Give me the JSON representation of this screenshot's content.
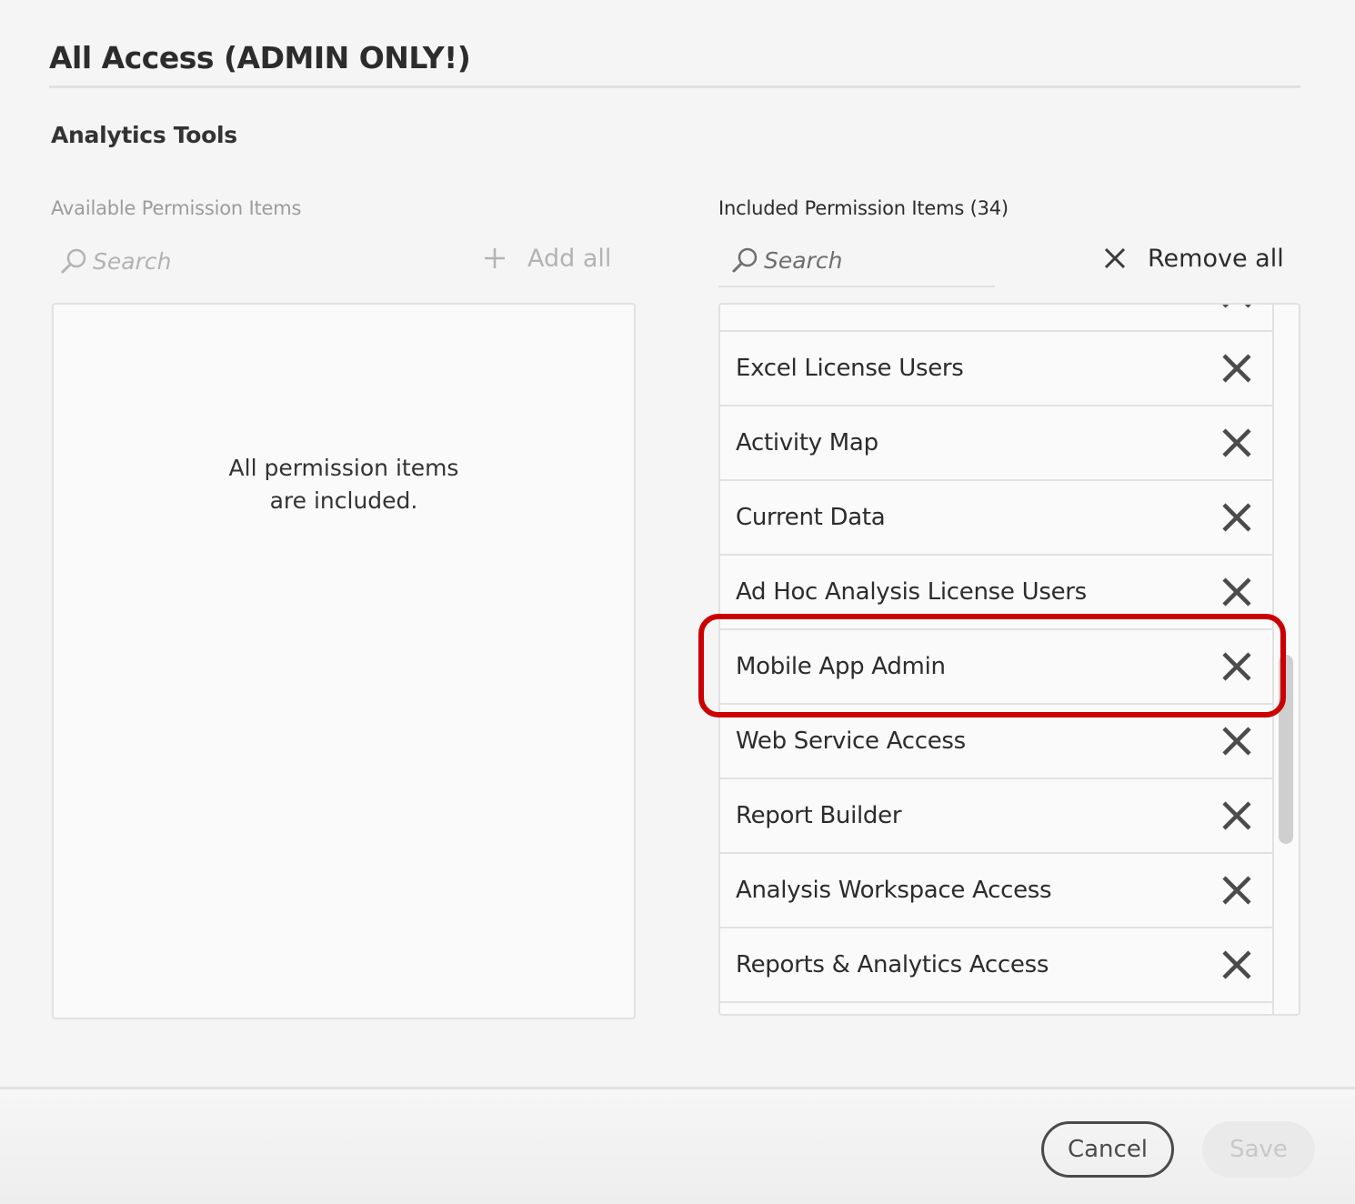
{
  "dialog": {
    "title": "All Access (ADMIN ONLY!)",
    "section_title": "Analytics Tools"
  },
  "available": {
    "label": "Available Permission Items",
    "search_placeholder": "Search",
    "add_all_label": "Add all",
    "empty_message": "All permission items are included."
  },
  "included": {
    "label": "Included Permission Items (34)",
    "search_placeholder": "Search",
    "remove_all_label": "Remove all",
    "items": [
      "",
      "Excel License Users",
      "Activity Map",
      "Current Data",
      "Ad Hoc Analysis License Users",
      "Mobile App Admin",
      "Web Service Access",
      "Report Builder",
      "Analysis Workspace Access",
      "Reports & Analytics Access"
    ],
    "highlighted_item": "Mobile App Admin"
  },
  "footer": {
    "cancel_label": "Cancel",
    "save_label": "Save"
  },
  "colors": {
    "highlight": "#cc0000",
    "text": "#2c2c2c",
    "muted": "#b3b3b3"
  },
  "icons": {
    "search": "search-icon",
    "add": "plus-icon",
    "remove": "close-icon"
  }
}
